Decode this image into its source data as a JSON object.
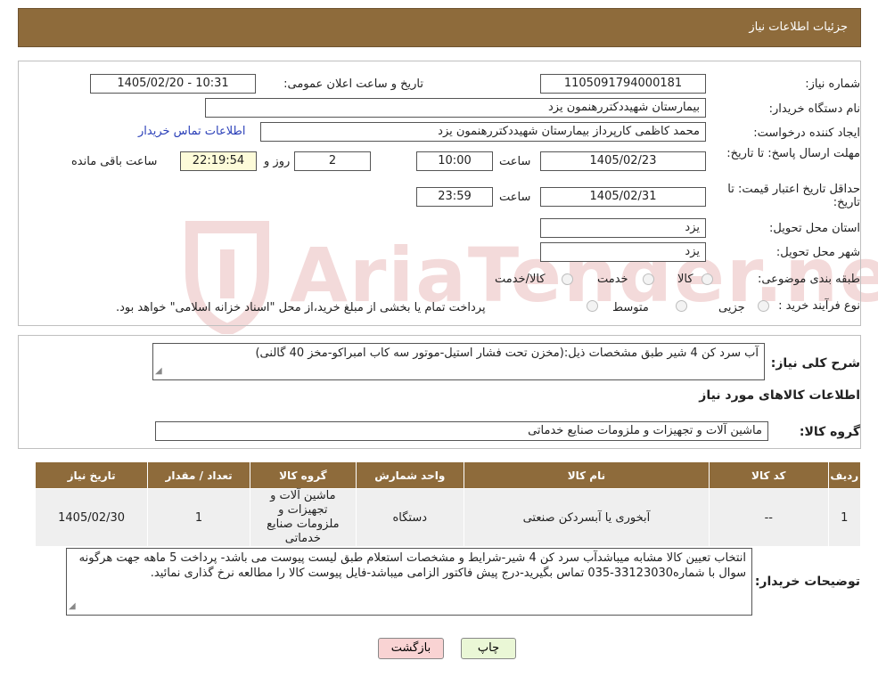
{
  "header": {
    "title": "جزئیات اطلاعات نیاز"
  },
  "fields": {
    "need_number_label": "شماره نیاز:",
    "need_number": "1105091794000181",
    "announce_label": "تاریخ و ساعت اعلان عمومی:",
    "announce_value": "1405/02/20 - 10:31",
    "buyer_org_label": "نام دستگاه خریدار:",
    "buyer_org": "بیمارستان شهیددکتررهنمون یزد",
    "requester_label": "ایجاد کننده درخواست:",
    "requester": "محمد کاظمی کارپرداز بیمارستان شهیددکتررهنمون یزد",
    "contact_link": "اطلاعات تماس خریدار",
    "deadline_label": "مهلت ارسال پاسخ: تا تاریخ:",
    "deadline_date": "1405/02/23",
    "time_label": "ساعت",
    "deadline_time": "10:00",
    "days_value": "2",
    "days_label": "روز و",
    "remaining_time": "22:19:54",
    "remaining_label": "ساعت باقی مانده",
    "price_validity_label": "حداقل تاریخ اعتبار قیمت: تا تاریخ:",
    "price_validity_date": "1405/02/31",
    "price_validity_time": "23:59",
    "province_label": "استان محل تحویل:",
    "province": "یزد",
    "city_label": "شهر محل تحویل:",
    "city": "یزد",
    "category_label": "طبقه بندی موضوعی:",
    "category_options": [
      "کالا",
      "خدمت",
      "کالا/خدمت"
    ],
    "purchase_type_label": "نوع فرآیند خرید :",
    "purchase_options": [
      "جزیی",
      "متوسط"
    ],
    "purchase_note": "پرداخت تمام یا بخشی از مبلغ خرید،از محل \"اسناد خزانه اسلامی\" خواهد بود."
  },
  "description": {
    "label": "شرح کلی نیاز:",
    "text": "آب سرد کن 4 شیر طبق مشخصات ذیل:(مخزن تحت فشار استیل-موتور سه کاب امبراکو-مخز 40 گالنی)"
  },
  "goods_section": {
    "title": "اطلاعات کالاهای مورد نیاز",
    "group_label": "گروه کالا:",
    "group_value": "ماشین آلات و تجهیزات و ملزومات صنایع خدماتی"
  },
  "table": {
    "headers": [
      "ردیف",
      "کد کالا",
      "نام کالا",
      "واحد شمارش",
      "گروه کالا",
      "تعداد / مقدار",
      "تاریخ نیاز"
    ],
    "rows": [
      [
        "1",
        "--",
        "آبخوری یا آبسردکن صنعتی",
        "دستگاه",
        "ماشین آلات و تجهیزات و ملزومات صنایع خدماتی",
        "1",
        "1405/02/30"
      ]
    ]
  },
  "buyer_notes": {
    "label": "توضیحات خریدار:",
    "text": "انتخاب تعیین کالا مشابه میباشدآب سرد کن 4 شیر-شرایط و مشخصات استعلام طبق لیست پیوست می باشد- پرداخت 5 ماهه جهت هرگونه سوال با شماره33123030-035 تماس بگیرید-درج پیش فاکتور الزامی میباشد-فایل پیوست کالا را مطالعه نرخ گذاری نمائید."
  },
  "buttons": {
    "print": "چاپ",
    "back": "بازگشت"
  },
  "watermark": "AriaTender.neT",
  "colors": {
    "header_bg": "#8e6b3b",
    "link": "#2a3fb8",
    "yellow_box": "#fdfbd9",
    "back_btn": "#f9d3d3",
    "print_btn": "#eaf7d6"
  }
}
